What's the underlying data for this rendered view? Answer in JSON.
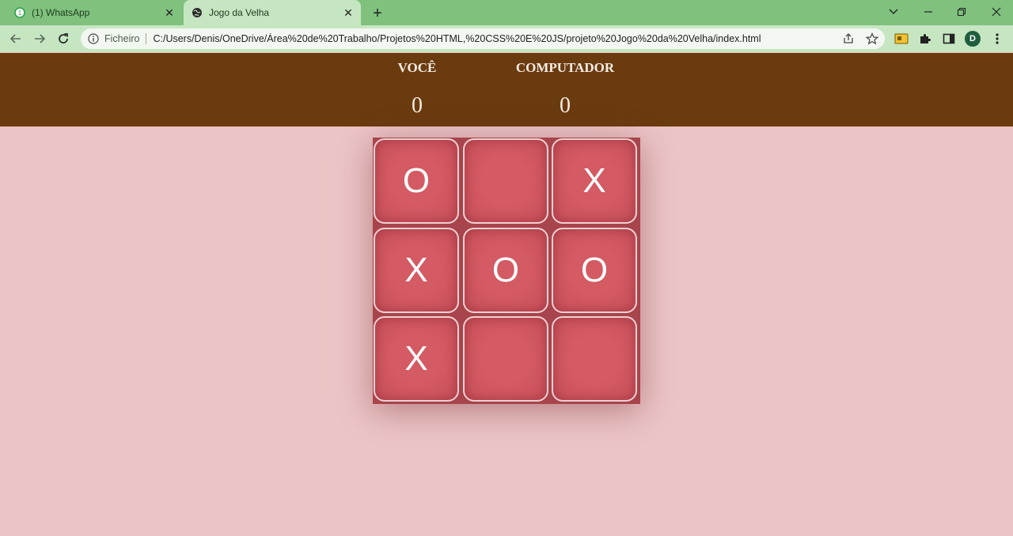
{
  "browser": {
    "tabs": [
      {
        "label": "(1) WhatsApp",
        "icon": "whatsapp-icon"
      },
      {
        "label": "Jogo da Velha",
        "icon": "globe-icon"
      }
    ],
    "address": {
      "scheme_label": "Ficheiro",
      "url": "C:/Users/Denis/OneDrive/Área%20de%20Trabalho/Projetos%20HTML,%20CSS%20E%20JS/projeto%20Jogo%20da%20Velha/index.html"
    },
    "profile_initial": "D"
  },
  "scoreboard": {
    "player_label": "VOCÊ",
    "player_score": "0",
    "computer_label": "COMPUTADOR",
    "computer_score": "0"
  },
  "board": {
    "cells": [
      "O",
      "",
      "X",
      "X",
      "O",
      "O",
      "X",
      "",
      ""
    ]
  },
  "colors": {
    "page_background": "#ebc5c6",
    "scoreboard_background": "#6b3b10",
    "cell_color": "#d45a63",
    "tabstrip": "#7fc17d"
  }
}
